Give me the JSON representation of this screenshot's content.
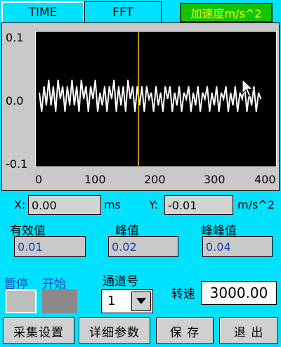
{
  "tabs": [
    {
      "label": "TIME"
    },
    {
      "label": "FFT"
    }
  ],
  "unit_badge": "加速度m/s^2",
  "chart_data": {
    "type": "line",
    "title": "",
    "xlabel": "",
    "ylabel": "",
    "xlim": [
      0,
      400
    ],
    "ylim": [
      -0.1,
      0.1
    ],
    "x_ticks": [
      "0",
      "100",
      "200",
      "300",
      "400"
    ],
    "y_ticks": [
      "0.1",
      "0.0",
      "-0.1"
    ],
    "cursor_x": 170,
    "series": [
      {
        "color": "#ffffff",
        "points": [
          [
            0,
            0.01
          ],
          [
            4,
            -0.02
          ],
          [
            8,
            0.02
          ],
          [
            12,
            -0.01
          ],
          [
            16,
            0.03
          ],
          [
            20,
            -0.01
          ],
          [
            24,
            0.02
          ],
          [
            28,
            -0.02
          ],
          [
            32,
            0.03
          ],
          [
            36,
            0.0
          ],
          [
            40,
            0.02
          ],
          [
            44,
            -0.02
          ],
          [
            48,
            0.02
          ],
          [
            52,
            -0.01
          ],
          [
            56,
            0.03
          ],
          [
            60,
            -0.01
          ],
          [
            64,
            0.02
          ],
          [
            68,
            -0.02
          ],
          [
            72,
            0.03
          ],
          [
            76,
            0.0
          ],
          [
            80,
            0.02
          ],
          [
            84,
            -0.02
          ],
          [
            88,
            0.02
          ],
          [
            92,
            0.0
          ],
          [
            96,
            0.03
          ],
          [
            100,
            -0.02
          ],
          [
            104,
            0.01
          ],
          [
            108,
            -0.01
          ],
          [
            112,
            0.02
          ],
          [
            116,
            -0.02
          ],
          [
            120,
            0.02
          ],
          [
            124,
            0.0
          ],
          [
            128,
            0.03
          ],
          [
            132,
            -0.02
          ],
          [
            136,
            0.02
          ],
          [
            140,
            -0.01
          ],
          [
            144,
            0.02
          ],
          [
            148,
            -0.02
          ],
          [
            152,
            0.03
          ],
          [
            156,
            0.0
          ],
          [
            160,
            0.02
          ],
          [
            164,
            -0.02
          ],
          [
            168,
            0.02
          ],
          [
            172,
            -0.01
          ],
          [
            176,
            0.02
          ],
          [
            180,
            -0.02
          ],
          [
            184,
            0.02
          ],
          [
            188,
            0.0
          ],
          [
            192,
            0.01
          ],
          [
            196,
            -0.02
          ],
          [
            200,
            0.02
          ],
          [
            204,
            -0.01
          ],
          [
            208,
            0.01
          ],
          [
            212,
            -0.02
          ],
          [
            216,
            0.02
          ],
          [
            220,
            0.0
          ],
          [
            224,
            0.02
          ],
          [
            228,
            -0.02
          ],
          [
            232,
            0.01
          ],
          [
            236,
            -0.01
          ],
          [
            240,
            0.02
          ],
          [
            244,
            -0.02
          ],
          [
            248,
            0.01
          ],
          [
            252,
            0.0
          ],
          [
            256,
            0.02
          ],
          [
            260,
            -0.02
          ],
          [
            264,
            0.01
          ],
          [
            268,
            -0.01
          ],
          [
            272,
            0.02
          ],
          [
            276,
            -0.02
          ],
          [
            280,
            0.01
          ],
          [
            284,
            0.0
          ],
          [
            288,
            0.02
          ],
          [
            292,
            -0.02
          ],
          [
            296,
            0.01
          ],
          [
            300,
            -0.01
          ],
          [
            304,
            0.02
          ],
          [
            308,
            -0.02
          ],
          [
            312,
            0.01
          ],
          [
            316,
            0.0
          ],
          [
            320,
            0.02
          ],
          [
            324,
            -0.02
          ],
          [
            328,
            0.01
          ],
          [
            332,
            -0.01
          ],
          [
            336,
            0.02
          ],
          [
            340,
            -0.02
          ],
          [
            344,
            0.01
          ],
          [
            348,
            0.0
          ],
          [
            352,
            0.02
          ],
          [
            356,
            -0.02
          ],
          [
            360,
            0.01
          ],
          [
            364,
            -0.01
          ],
          [
            368,
            0.02
          ],
          [
            372,
            -0.02
          ],
          [
            376,
            0.01
          ],
          [
            380,
            0.0
          ]
        ]
      }
    ]
  },
  "readout": {
    "x_label": "X:",
    "x_value": "0.00",
    "x_unit": "ms",
    "y_label": "Y:",
    "y_value": "-0.01",
    "y_unit": "m/s^2"
  },
  "stats": {
    "rms_label": "有效值",
    "rms_value": "0.01",
    "peak_label": "峰值",
    "peak_value": "0.02",
    "p2p_label": "峰峰值",
    "p2p_value": "0.04"
  },
  "controls": {
    "pause_label": "暂停",
    "start_label": "开始",
    "channel_label": "通道号",
    "channel_value": "1",
    "speed_label": "转速",
    "speed_value": "3000.00"
  },
  "buttons": {
    "acq_settings": "采集设置",
    "detail_params": "详细参数",
    "save": "保 存",
    "exit": "退 出"
  }
}
